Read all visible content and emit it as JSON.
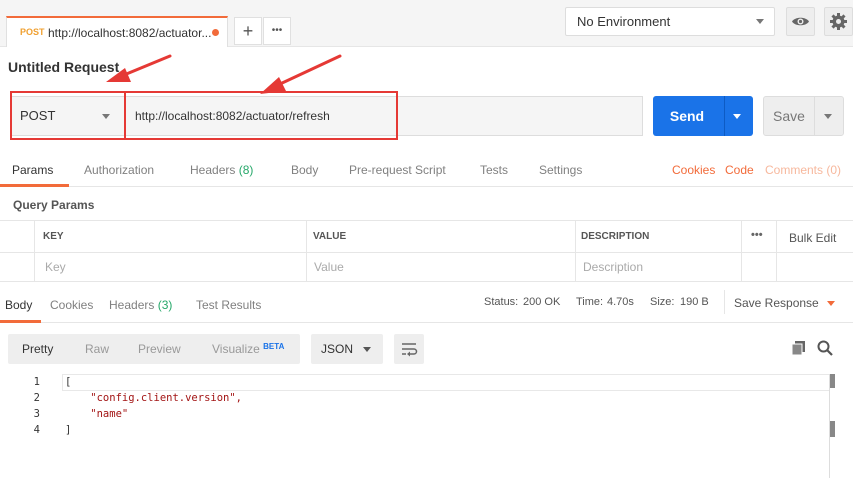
{
  "tab": {
    "method": "POST",
    "url": "http://localhost:8082/actuator..."
  },
  "tab_actions": {
    "new_tab": "+",
    "more": "•••"
  },
  "environment": {
    "selected": "No Environment"
  },
  "request": {
    "title": "Untitled Request",
    "method": "POST",
    "url": "http://localhost:8082/actuator/refresh",
    "send_label": "Send",
    "save_label": "Save"
  },
  "request_tabs": {
    "params": "Params",
    "authorization": "Authorization",
    "headers": "Headers",
    "headers_count": "(8)",
    "body": "Body",
    "prerequest": "Pre-request Script",
    "tests": "Tests",
    "settings": "Settings",
    "cookies": "Cookies",
    "code": "Code",
    "comments": "Comments (0)"
  },
  "query_params": {
    "heading": "Query Params",
    "col_key": "KEY",
    "col_value": "VALUE",
    "col_description": "DESCRIPTION",
    "more": "•••",
    "bulk_edit": "Bulk Edit",
    "ph_key": "Key",
    "ph_value": "Value",
    "ph_description": "Description"
  },
  "response_tabs": {
    "body": "Body",
    "cookies": "Cookies",
    "headers": "Headers",
    "headers_count": "(3)",
    "test_results": "Test Results"
  },
  "response_status": {
    "status_label": "Status:",
    "status_value": "200 OK",
    "time_label": "Time:",
    "time_value": "4.70s",
    "size_label": "Size:",
    "size_value": "190 B",
    "save_response": "Save Response"
  },
  "view_modes": {
    "pretty": "Pretty",
    "raw": "Raw",
    "preview": "Preview",
    "visualize": "Visualize",
    "beta": "BETA",
    "format": "JSON"
  },
  "response_body": {
    "line_numbers": [
      "1",
      "2",
      "3",
      "4"
    ],
    "line1": "[",
    "line2": "    \"config.client.version\",",
    "line3": "    \"name\"",
    "line4": "]"
  },
  "colors": {
    "accent": "#f26b3a",
    "send": "#1a73e8",
    "success": "#26a86a",
    "annotation": "#e53935"
  }
}
